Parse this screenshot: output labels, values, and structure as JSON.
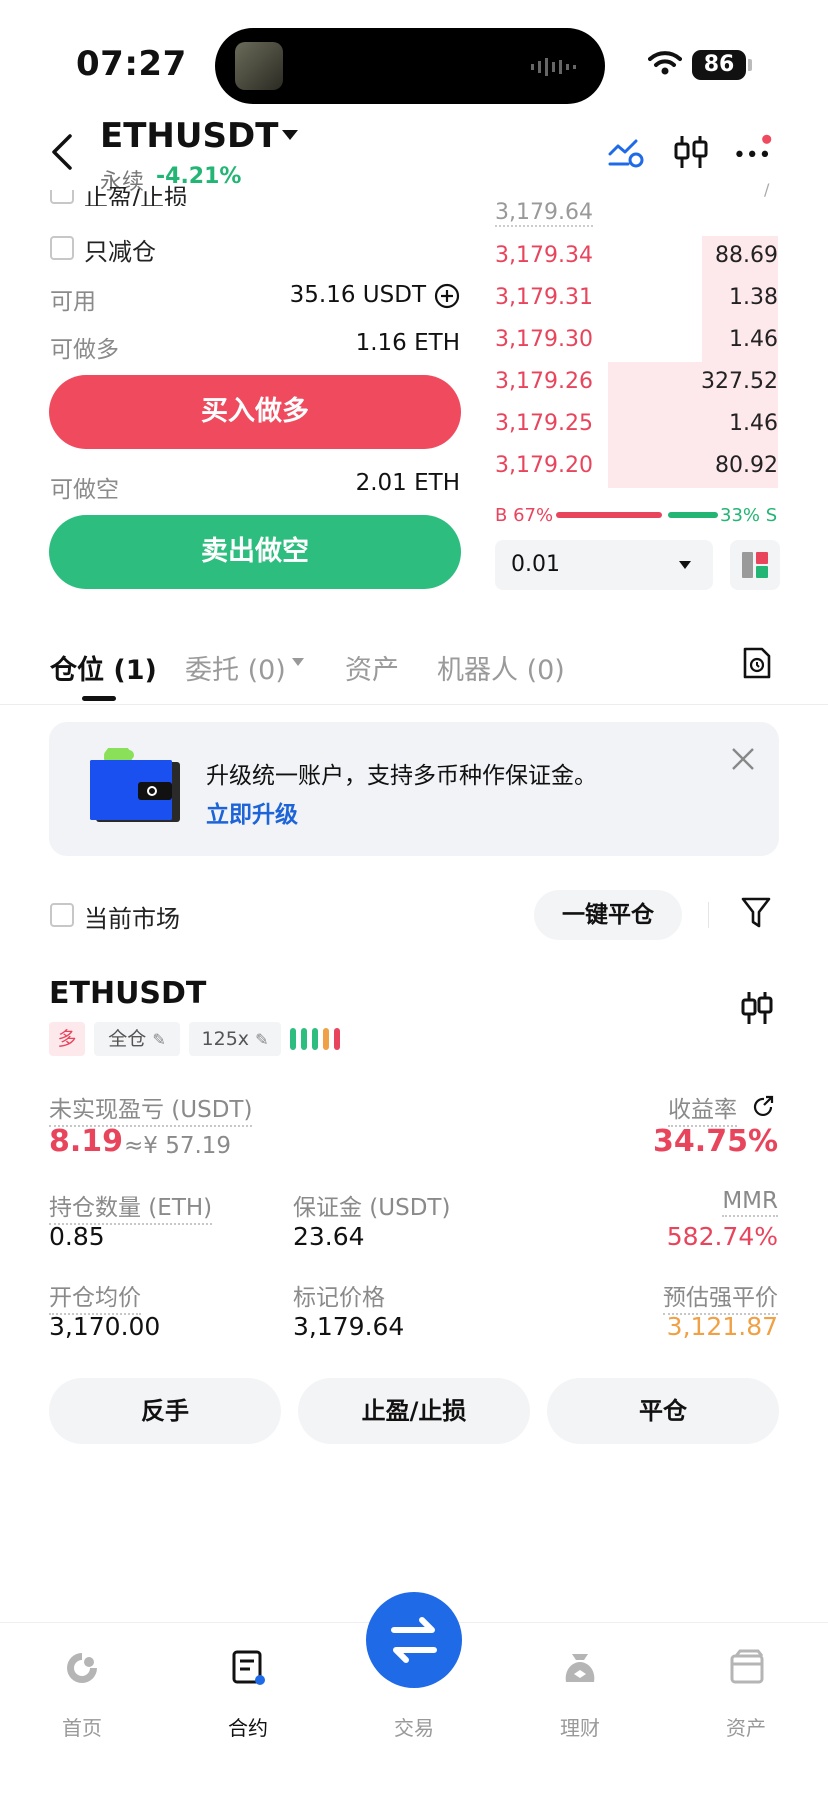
{
  "status_bar": {
    "time": "07:27",
    "battery": "86"
  },
  "header": {
    "pair": "ETHUSDT",
    "type": "永续",
    "change": "-4.21%"
  },
  "order_form": {
    "tp_sl_label": "止盈/止损",
    "reduce_only_label": "只减仓",
    "available_label": "可用",
    "available_value": "35.16 USDT",
    "max_long_label": "可做多",
    "max_long_value": "1.16 ETH",
    "buy_button": "买入做多",
    "max_short_label": "可做空",
    "max_short_value": "2.01 ETH",
    "sell_button": "卖出做空"
  },
  "order_book": {
    "top_price": "3,179.64",
    "rows": [
      {
        "price": "3,179.34",
        "size": "88.69",
        "depth": 0.27
      },
      {
        "price": "3,179.31",
        "size": "1.38",
        "depth": 0.27
      },
      {
        "price": "3,179.30",
        "size": "1.46",
        "depth": 0.27
      },
      {
        "price": "3,179.26",
        "size": "327.52",
        "depth": 0.6
      },
      {
        "price": "3,179.25",
        "size": "1.46",
        "depth": 0.6
      },
      {
        "price": "3,179.20",
        "size": "80.92",
        "depth": 0.6
      }
    ],
    "buy_ratio": "B 67%",
    "sell_ratio": "33% S",
    "precision": "0.01"
  },
  "tabs": [
    {
      "label": "仓位 (1)"
    },
    {
      "label": "委托 (0)"
    },
    {
      "label": "资产"
    },
    {
      "label": "机器人 (0)"
    }
  ],
  "banner": {
    "text": "升级统一账户，支持多币种作保证金。",
    "link": "立即升级"
  },
  "filter": {
    "current_market_label": "当前市场",
    "close_all_button": "一键平仓"
  },
  "position": {
    "symbol": "ETHUSDT",
    "side_tag": "多",
    "margin_mode_tag": "全仓",
    "leverage_tag": "125x",
    "unrealized_pnl_label": "未实现盈亏 (USDT)",
    "unrealized_pnl": "8.19",
    "unrealized_pnl_cny": "≈¥ 57.19",
    "roe_label": "收益率",
    "roe": "34.75%",
    "size_label": "持仓数量 (ETH)",
    "size": "0.85",
    "margin_label": "保证金 (USDT)",
    "margin": "23.64",
    "mmr_label": "MMR",
    "mmr": "582.74%",
    "entry_label": "开仓均价",
    "entry": "3,170.00",
    "mark_label": "标记价格",
    "mark": "3,179.64",
    "liq_label": "预估强平价",
    "liq": "3,121.87",
    "reverse_button": "反手",
    "tpsl_button": "止盈/止损",
    "close_button": "平仓"
  },
  "bottom_nav": [
    {
      "label": "首页"
    },
    {
      "label": "合约"
    },
    {
      "label": "交易"
    },
    {
      "label": "理财"
    },
    {
      "label": "资产"
    }
  ],
  "colors": {
    "red": "#e8455d",
    "green": "#22b573",
    "blue": "#1f6ae6",
    "orange": "#f0a045"
  }
}
